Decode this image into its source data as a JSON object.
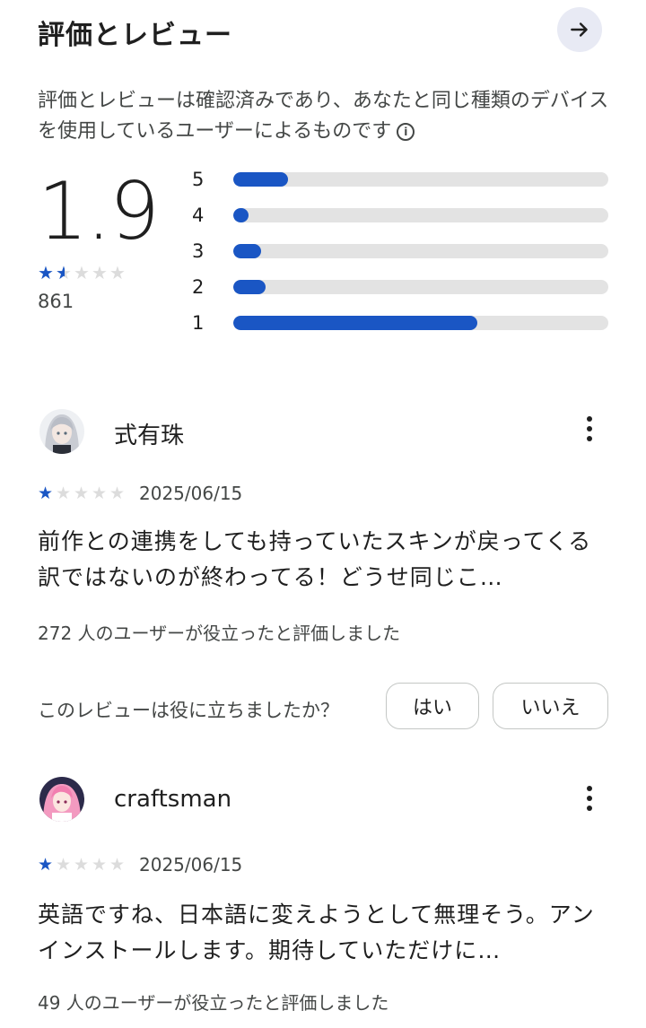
{
  "header": {
    "title": "評価とレビュー",
    "arrow_icon": "arrow-right-icon"
  },
  "description": {
    "text": "評価とレビューは確認済みであり、あなたと同じ種類のデバイスを使用しているユーザーによるものです",
    "info_icon": "info-icon",
    "info_glyph": "i"
  },
  "summary": {
    "average": "1.9",
    "star_rating": 1.5,
    "review_count": "861",
    "distribution": [
      {
        "label": "5",
        "fraction": 0.145
      },
      {
        "label": "4",
        "fraction": 0.04
      },
      {
        "label": "3",
        "fraction": 0.075
      },
      {
        "label": "2",
        "fraction": 0.085
      },
      {
        "label": "1",
        "fraction": 0.65
      }
    ],
    "accent_color": "#1a56c4"
  },
  "reviews": [
    {
      "author": "式有珠",
      "rating": 1,
      "date": "2025/06/15",
      "text": "前作との連携をしても持っていたスキンが戻ってくる訳ではないのが終わってる！どうせ同じこ…",
      "helpful_text": "272 人のユーザーが役立ったと評価しました",
      "question": "このレビューは役に立ちましたか？",
      "yes_label": "はい",
      "no_label": "いいえ"
    },
    {
      "author": "craftsman",
      "rating": 1,
      "date": "2025/06/15",
      "text": "英語ですね、日本語に変えようとして無理そう。アンインストールします。期待していただけに…",
      "helpful_text": "49 人のユーザーが役立ったと評価しました"
    }
  ]
}
